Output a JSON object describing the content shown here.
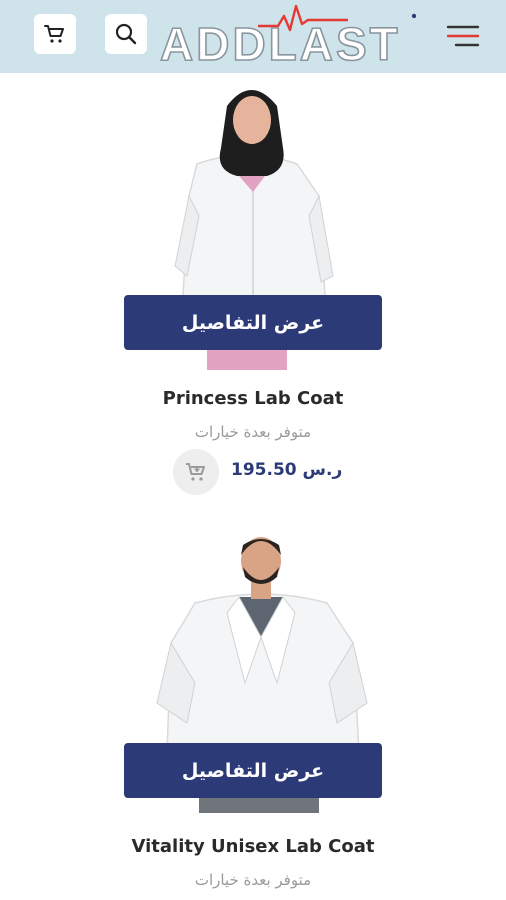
{
  "header": {
    "logo_text": "ADDLAST",
    "cart_icon": "cart-icon",
    "search_icon": "search-icon",
    "menu_icon": "hamburger-menu-icon"
  },
  "products": [
    {
      "details_label": "عرض التفاصيل",
      "name": "Princess Lab Coat",
      "availability": "متوفر بعدة خيارات",
      "price": "195.50 ر.س"
    },
    {
      "details_label": "عرض التفاصيل",
      "name": "Vitality Unisex Lab Coat",
      "availability": "متوفر بعدة خيارات"
    }
  ],
  "colors": {
    "header_bg": "#cfe4ea",
    "button_bg": "#2c3a78",
    "logo_accent": "#e53935"
  }
}
